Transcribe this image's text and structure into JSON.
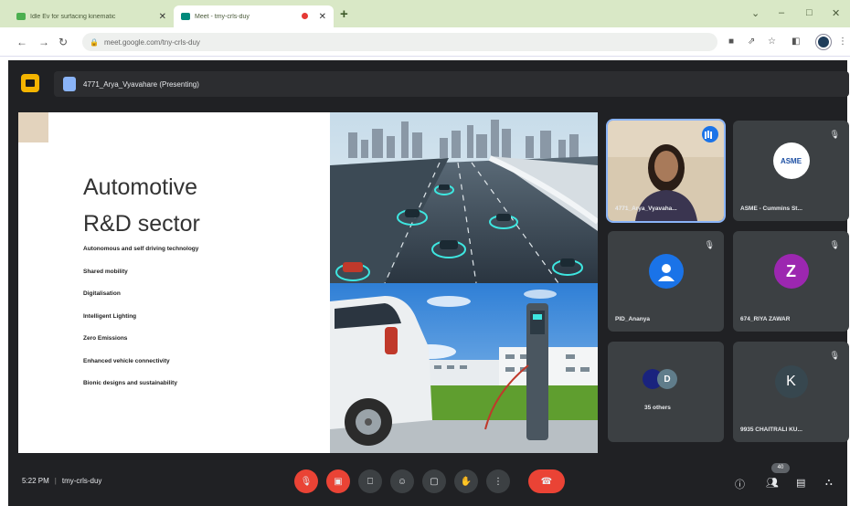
{
  "browser": {
    "tabs": [
      {
        "title": "Idle Ev for surfacing kinematic",
        "favicon_color": "#4caf50"
      },
      {
        "title": "Meet - tmy-crls-duy",
        "favicon_color": "#00897b"
      }
    ],
    "new_tab": "+",
    "window_controls": {
      "minimize": "–",
      "maximize": "□",
      "close": "✕"
    },
    "url": "meet.google.com/tny-crls-duy"
  },
  "meet": {
    "presenter_banner": "4771_Arya_Vyavahare (Presenting)",
    "slide": {
      "title_line1": "Automotive",
      "title_line2": "R&D sector",
      "bullets": [
        "Autonomous and self driving technology",
        "Shared mobility",
        "Digitalisation",
        "Intelligent Lighting",
        "Zero Emissions",
        "Enhanced vehicle connectivity",
        "Bionic designs and sustainability"
      ]
    },
    "tiles": [
      {
        "name": "4771_Arya_Vyavaha...",
        "type": "video",
        "speaking": true
      },
      {
        "name": "ASME - Cummins St...",
        "type": "logo",
        "logo_text": "ASME",
        "muted": true
      },
      {
        "name": "PID_Ananya",
        "type": "person-icon",
        "muted": true
      },
      {
        "name": "674_RIYA ZAWAR",
        "type": "letter",
        "letter": "Z",
        "color": "#9c27b0",
        "muted": true
      },
      {
        "name": "35 others",
        "type": "others",
        "letter": "D",
        "muted": false
      },
      {
        "name": "9935 CHAITRALI KU...",
        "type": "letter",
        "letter": "K",
        "color": "#37474f",
        "muted": true
      }
    ],
    "bottom": {
      "time": "5:22 PM",
      "meeting_code": "tmy-crls-duy",
      "participant_count": "40"
    }
  }
}
